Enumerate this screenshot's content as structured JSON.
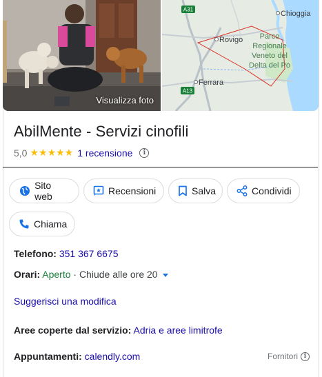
{
  "photo": {
    "label": "Visualizza foto"
  },
  "map": {
    "labels": {
      "road_a31": "A31",
      "road_a13": "A13",
      "chioggia": "Chioggia",
      "rovigo": "Rovigo",
      "ferrara": "Ferrara",
      "park": [
        "Parco",
        "Regionale",
        "Veneto del",
        "Delta del Po"
      ]
    }
  },
  "business": {
    "name": "AbilMente - Servizi cinofili",
    "rating": "5,0",
    "stars": "★★★★★",
    "reviews": "1 recensione",
    "info_symbol": "i"
  },
  "actions": {
    "website": "Sito web",
    "reviews": "Recensioni",
    "save": "Salva",
    "share": "Condividi",
    "call": "Chiama"
  },
  "details": {
    "phone_label": "Telefono:",
    "phone_value": "351 367 6675",
    "hours_label": "Orari:",
    "hours_status": "Aperto",
    "hours_detail": "· Chiude alle ore 20",
    "suggest_edit": "Suggerisci una modifica",
    "service_area_label": "Aree coperte dal servizio:",
    "service_area_value": "Adria e aree limitrofe",
    "appointments_label": "Appuntamenti:",
    "appointments_value": "calendly.com",
    "suppliers": "Fornitori"
  },
  "colors": {
    "link": "#1a0dab",
    "accent_blue": "#1a73e8",
    "open_green": "#188038",
    "star": "#fbbc04",
    "park_outline": "#d93025"
  },
  "icons": {
    "website": "globe-icon",
    "reviews": "review-icon",
    "save": "bookmark-icon",
    "share": "share-icon",
    "call": "phone-icon",
    "info": "info-icon",
    "hours_dropdown": "caret-down-icon"
  }
}
